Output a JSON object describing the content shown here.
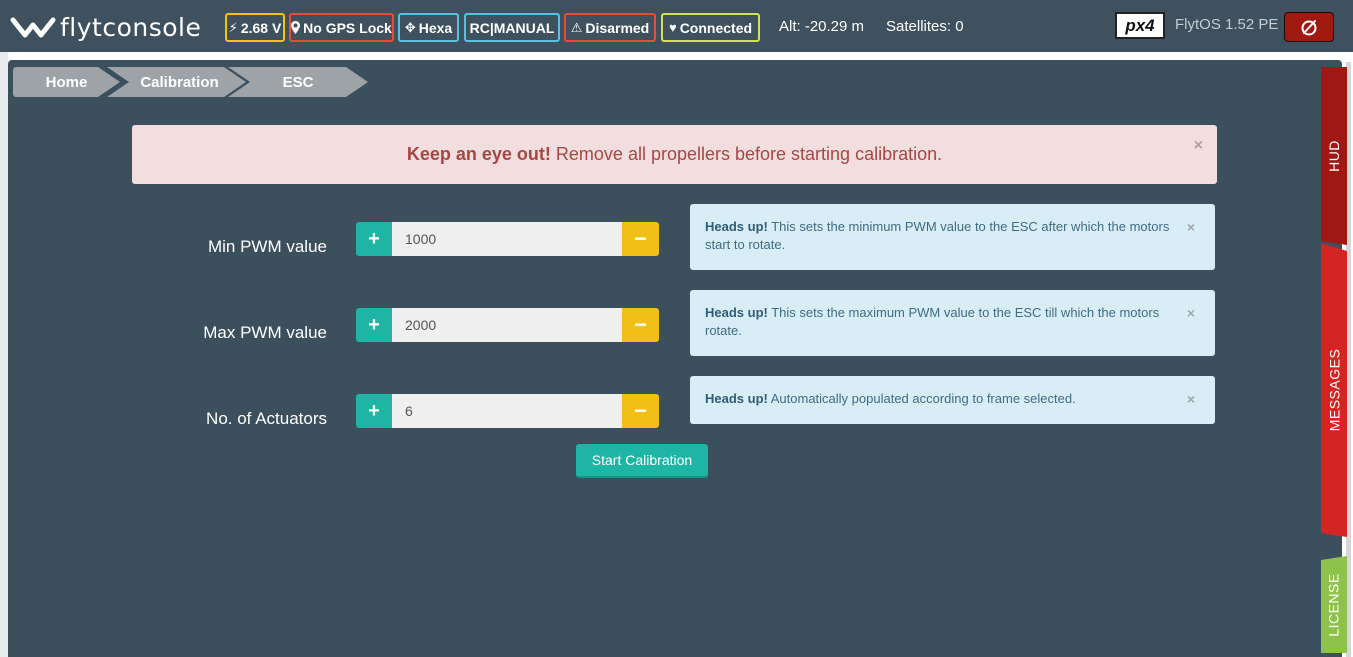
{
  "app": {
    "brand": "flytconsole"
  },
  "header": {
    "badges": [
      {
        "label": "2.68 V",
        "icon": "bolt-icon",
        "color": "#f1c40f"
      },
      {
        "label": "No GPS Lock",
        "icon": "map-marker-icon",
        "color": "#e74c3c"
      },
      {
        "label": "Hexa",
        "icon": "move-arrows-icon",
        "color": "#5bc0de"
      },
      {
        "label": "RC|MANUAL",
        "icon": "",
        "color": "#5bc0de"
      },
      {
        "label": "Disarmed",
        "icon": "warning-icon",
        "color": "#e74c3c"
      },
      {
        "label": "Connected",
        "icon": "heart-icon",
        "color": "#d4e157"
      }
    ],
    "altitude": "Alt: -20.29 m",
    "satellites": "Satellites: 0",
    "autopilot_logo": "px4",
    "version": "FlytOS 1.52 PE",
    "power_icon": "power-icon"
  },
  "breadcrumb": [
    "Home",
    "Calibration",
    "ESC"
  ],
  "alert": {
    "strong": "Keep an eye out!",
    "text": "Remove all propellers before starting calibration.",
    "close": "×"
  },
  "rows": [
    {
      "label": "Min PWM value",
      "value": "1000",
      "plus": "+",
      "minus": "−",
      "info_strong": "Heads up!",
      "info_text": "This sets the minimum PWM value to the ESC after which the motors start to rotate.",
      "close": "×"
    },
    {
      "label": "Max PWM value",
      "value": "2000",
      "plus": "+",
      "minus": "−",
      "info_strong": "Heads up!",
      "info_text": "This sets the maximum PWM value to the ESC till which the motors rotate.",
      "close": "×"
    },
    {
      "label": "No. of Actuators",
      "value": "6",
      "plus": "+",
      "minus": "−",
      "info_strong": "Heads up!",
      "info_text": "Automatically populated according to frame selected.",
      "close": "×"
    }
  ],
  "start_button": "Start Calibration",
  "side_tabs": {
    "hud": "HUD",
    "messages": "MESSAGES",
    "license": "LICENSE"
  }
}
